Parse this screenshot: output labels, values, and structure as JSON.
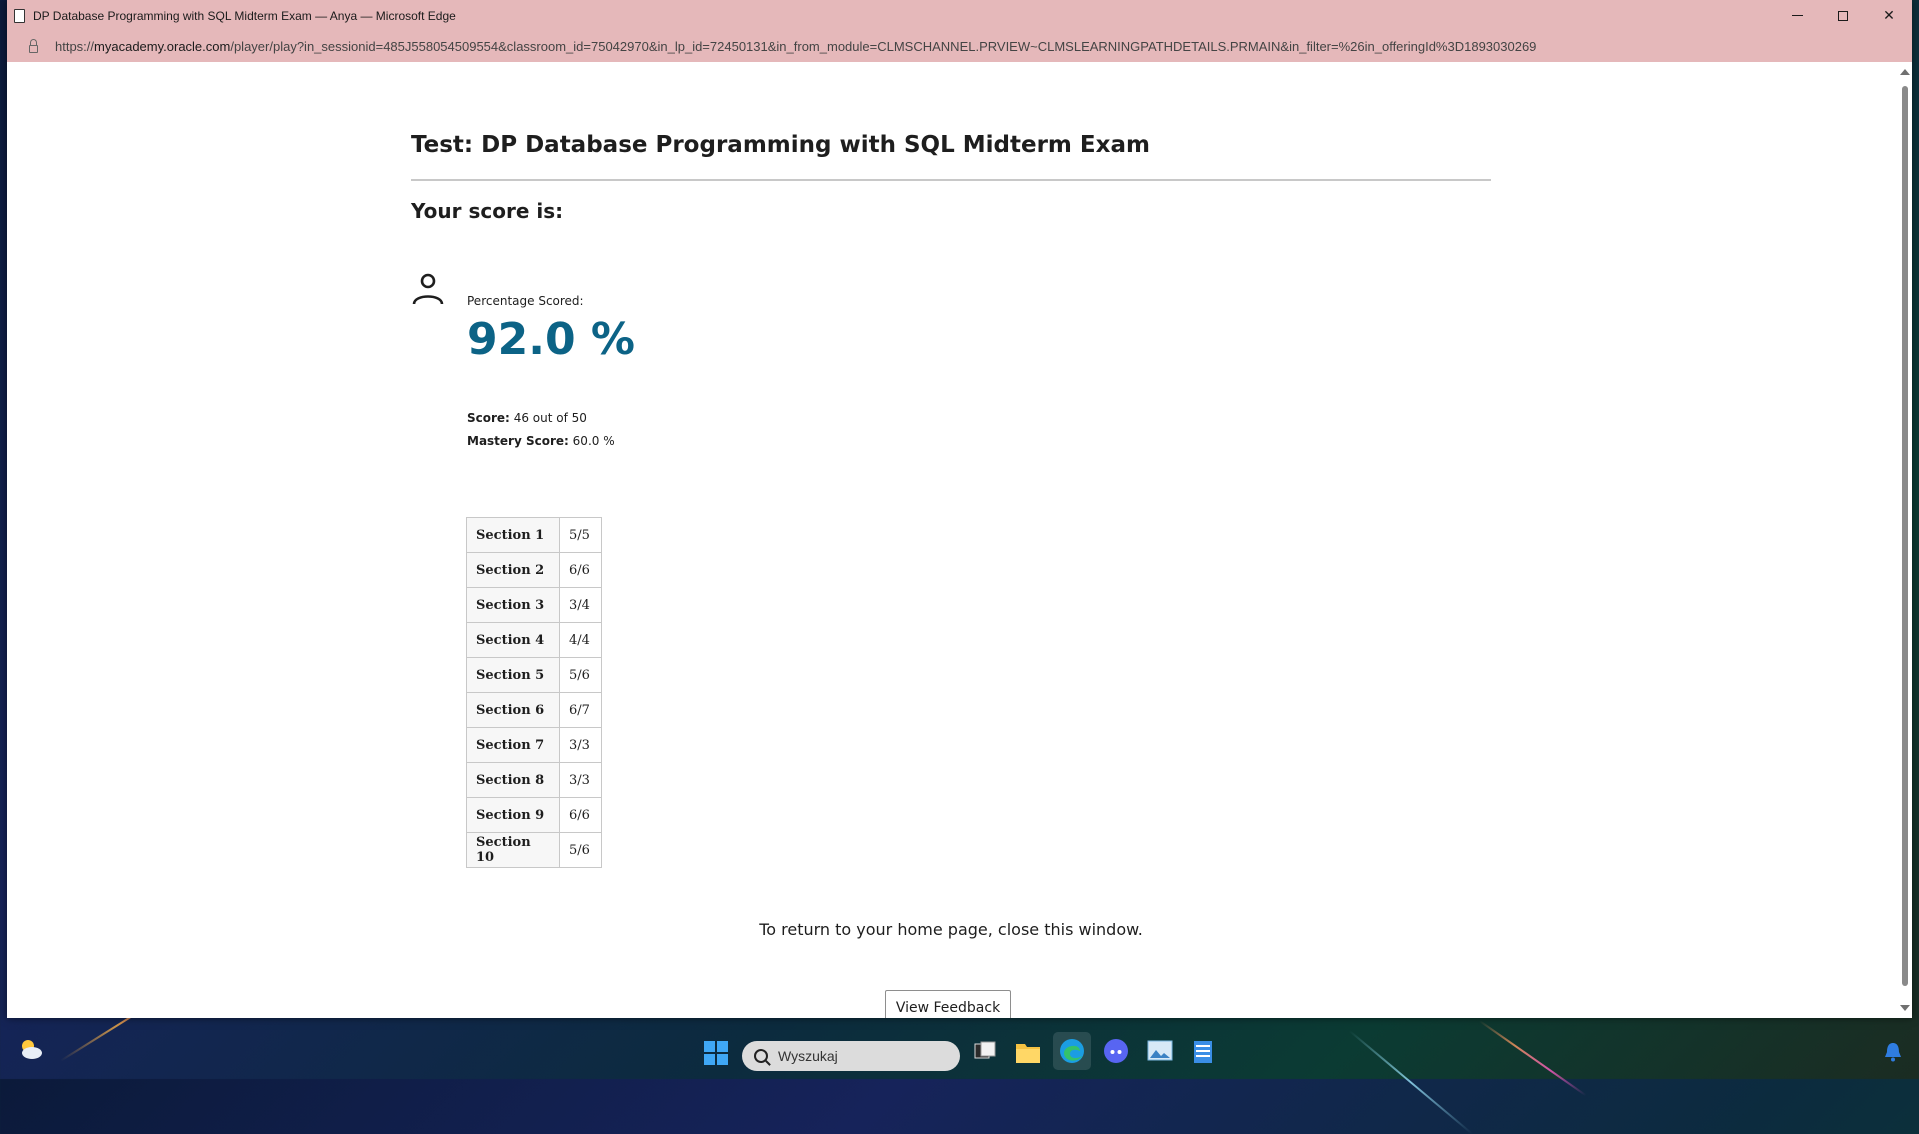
{
  "window": {
    "title": "DP Database Programming with SQL Midterm Exam — Anya — Microsoft Edge",
    "url_prefix": "https://",
    "url_host": "myacademy.oracle.com",
    "url_path": "/player/play?in_sessionid=485J558054509554&classroom_id=75042970&in_lp_id=72450131&in_from_module=CLMSCHANNEL.PRVIEW~CLMSLEARNINGPATHDETAILS.PRMAIN&in_filter=%26in_offeringId%3D1893030269",
    "controls": {
      "minimize": "",
      "maximize": "",
      "close": "✕"
    }
  },
  "page": {
    "test_title": "Test: DP Database Programming with SQL Midterm Exam",
    "score_heading": "Your score is:",
    "percentage_label": "Percentage Scored:",
    "percentage_value": "92.0 %",
    "score_label": "Score:",
    "score_value": "46 out of 50",
    "mastery_label": "Mastery Score:",
    "mastery_value": "60.0 %",
    "sections": [
      {
        "name": "Section 1",
        "score": "5/5"
      },
      {
        "name": "Section 2",
        "score": "6/6"
      },
      {
        "name": "Section 3",
        "score": "3/4"
      },
      {
        "name": "Section 4",
        "score": "4/4"
      },
      {
        "name": "Section 5",
        "score": "5/6"
      },
      {
        "name": "Section 6",
        "score": "6/7"
      },
      {
        "name": "Section 7",
        "score": "3/3"
      },
      {
        "name": "Section 8",
        "score": "3/3"
      },
      {
        "name": "Section 9",
        "score": "6/6"
      },
      {
        "name": "Section 10",
        "score": "5/6"
      }
    ],
    "return_text": "To return to your home page, close this window.",
    "feedback_button": "View Feedback"
  },
  "taskbar": {
    "search_placeholder": "Wyszukaj",
    "icons": [
      "weather-icon",
      "windows-start-icon",
      "task-view-icon",
      "file-explorer-icon",
      "edge-icon",
      "discord-icon",
      "photos-icon",
      "notepad-icon"
    ]
  },
  "colors": {
    "titlebar": "#e5b8ba",
    "percentage": "#0c6386"
  }
}
